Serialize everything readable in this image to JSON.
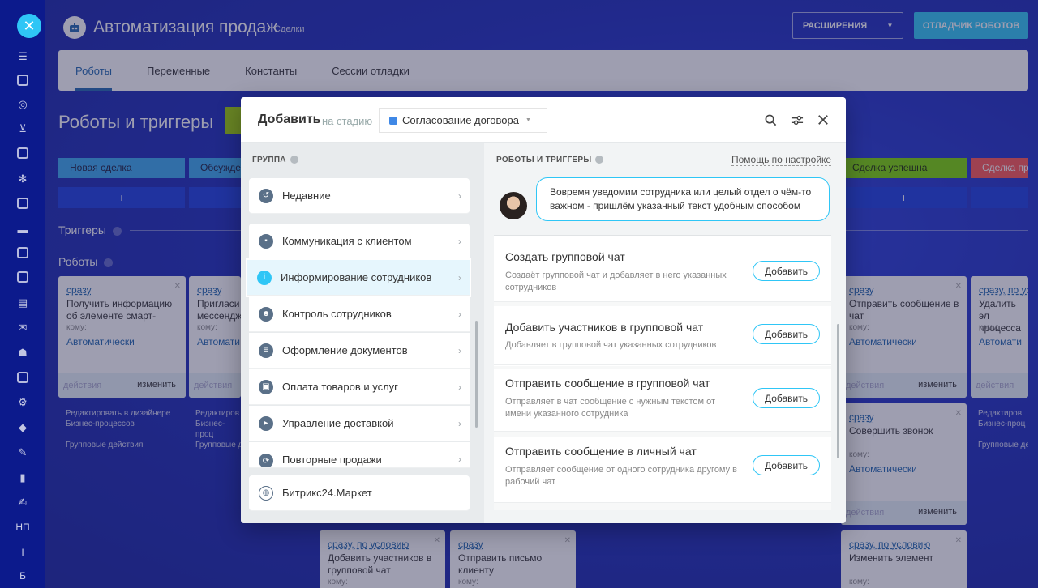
{
  "rail": {
    "bottom_labels": [
      "НП",
      "І",
      "Б"
    ]
  },
  "header": {
    "title": "Автоматизация продаж",
    "subtitle": "Сделки",
    "extensions_label": "РАСШИРЕНИЯ",
    "debug_label": "ОТЛАДЧИК РОБОТОВ"
  },
  "tabs": [
    "Роботы",
    "Переменные",
    "Константы",
    "Сессии отладки"
  ],
  "section_title": "Роботы и триггеры",
  "stages": [
    {
      "label": "Новая сделка",
      "color": "#39a8ef"
    },
    {
      "label": "Обсужден",
      "color": "#39a8ef"
    },
    {
      "label": "Сделка успешна",
      "color": "#7bd500"
    },
    {
      "label": "Сделка про",
      "color": "#ff5752"
    }
  ],
  "plus": "+",
  "triggers_label": "Триггеры",
  "robots_label": "Роботы",
  "cards": [
    {
      "when": "сразу",
      "name": "Получить информацию об элементе смарт-",
      "who_label": "кому:",
      "who": "Автоматически",
      "foot_a": "действия",
      "foot_b": "изменить"
    },
    {
      "when": "сразу",
      "name": "Пригласи мессендж",
      "who_label": "кому:",
      "who": "Автомати",
      "foot_a": "действия"
    },
    {
      "when": "сразу",
      "name": "Отправить сообщение в чат",
      "who_label": "кому:",
      "who": "Автоматически",
      "foot_a": "действия",
      "foot_b": "изменить"
    },
    {
      "when": "сразу, по ус",
      "name": "Удалить эл процесса",
      "who_label": "кому:",
      "who": "Автомати",
      "foot_a": "действия"
    },
    {
      "when": "сразу",
      "name": "Совершить звонок",
      "who_label": "кому:",
      "who": "Автоматически",
      "foot_a": "действия",
      "foot_b": "изменить"
    },
    {
      "when": "сразу, по условию",
      "name": "Добавить участников в групповой чат",
      "who_label": "кому:"
    },
    {
      "when": "сразу",
      "name": "Отправить письмо клиенту",
      "who_label": "кому:"
    },
    {
      "when": "сразу, по условию",
      "name": "Изменить элемент",
      "who_label": "кому:"
    }
  ],
  "links": {
    "edit_designer": "Редактировать в дизайнере Бизнес-процессов",
    "group_actions": "Групповые действия",
    "edit_designer_cut": "Редактиров Бизнес-проц",
    "group_actions_cut": "Групповые де",
    "edit_designer_right": "Редактиров Бизнес-проц",
    "group_actions_right": "Групповые де"
  },
  "modal": {
    "title": "Добавить",
    "stage_label": "на стадию",
    "stage_value": "Согласование договора",
    "stage_color": "#3f88e6",
    "group_header": "ГРУППА",
    "robots_header": "РОБОТЫ И ТРИГГЕРЫ",
    "help_link": "Помощь по настройке",
    "hint": "Вовремя уведомим сотрудника или целый отдел о чём-то важном - пришлём указанный текст удобным способом",
    "groups": [
      {
        "label": "Недавние",
        "icon": "history-icon"
      },
      {
        "label": "Коммуникация с клиентом",
        "icon": "chat-icon"
      },
      {
        "label": "Информирование сотрудников",
        "icon": "info-icon"
      },
      {
        "label": "Контроль сотрудников",
        "icon": "people-icon"
      },
      {
        "label": "Оформление документов",
        "icon": "document-icon"
      },
      {
        "label": "Оплата товаров и услуг",
        "icon": "wallet-icon"
      },
      {
        "label": "Управление доставкой",
        "icon": "truck-icon"
      },
      {
        "label": "Повторные продажи",
        "icon": "repeat-icon"
      }
    ],
    "market": "Битрикс24.Маркет",
    "items": [
      {
        "name": "Создать групповой чат",
        "desc": "Создаёт групповой чат и добавляет в него указанных сотрудников",
        "add": "Добавить"
      },
      {
        "name": "Добавить участников в групповой чат",
        "desc": "Добавляет в групповой чат указанных сотрудников",
        "add": "Добавить"
      },
      {
        "name": "Отправить сообщение в групповой чат",
        "desc": "Отправляет в чат сообщение с нужным текстом от имени указанного сотрудника",
        "add": "Добавить"
      },
      {
        "name": "Отправить сообщение в личный чат",
        "desc": "Отправляет сообщение от одного сотрудника другому в рабочий чат",
        "add": "Добавить"
      }
    ]
  }
}
